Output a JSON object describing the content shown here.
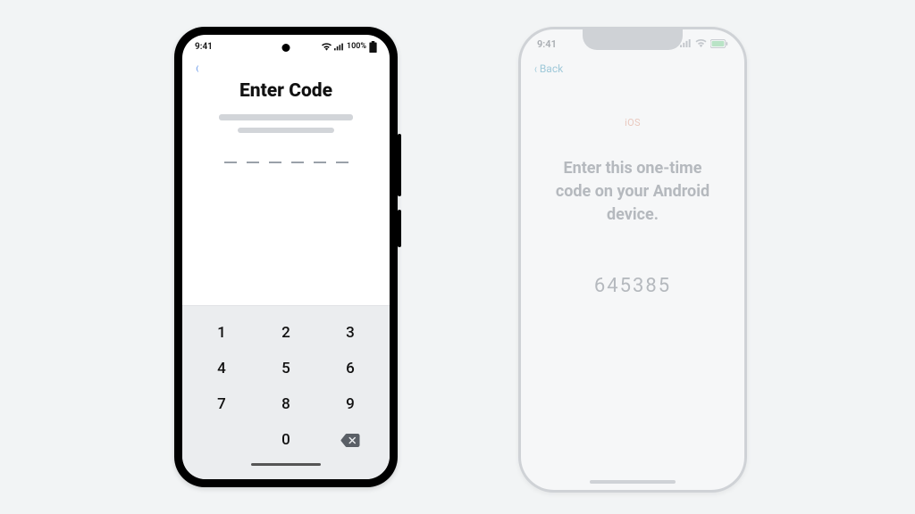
{
  "android": {
    "status": {
      "time": "9:41",
      "battery_text": "100%"
    },
    "title": "Enter Code",
    "code_slots": 6,
    "keypad": {
      "rows": [
        [
          "1",
          "2",
          "3"
        ],
        [
          "4",
          "5",
          "6"
        ],
        [
          "7",
          "8",
          "9"
        ],
        [
          "",
          "0",
          "del"
        ]
      ],
      "delete_icon": "backspace-icon"
    }
  },
  "iphone": {
    "status": {
      "time": "9:41"
    },
    "back_label": "Back",
    "app_label": "iOS",
    "message_line1": "Enter this one-time",
    "message_line2": "code on your Android",
    "message_line3": "device.",
    "code": "645385"
  }
}
